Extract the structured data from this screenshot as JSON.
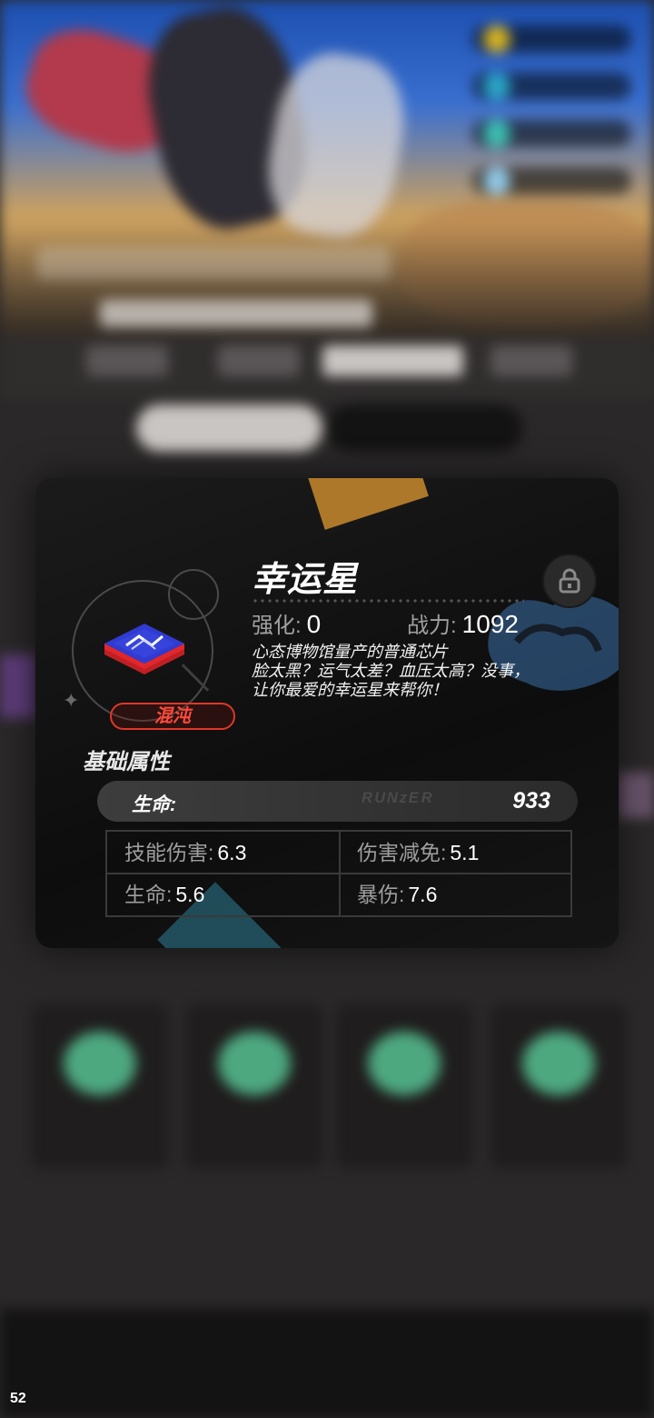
{
  "chip": {
    "name": "幸运星",
    "rarity": "混沌",
    "enhance_label": "强化:",
    "enhance_value": "0",
    "power_label": "战力:",
    "power_value": "1092",
    "description": [
      "心态博物馆量产的普通芯片",
      "脸太黑？运气太差？血压太高？没事，",
      "让你最爱的幸运星来帮你！"
    ]
  },
  "base_attributes": {
    "title": "基础属性",
    "main_label": "生命:",
    "main_value": "933"
  },
  "sub_stats": [
    {
      "label": "技能伤害:",
      "value": "6.3"
    },
    {
      "label": "伤害减免:",
      "value": "5.1"
    },
    {
      "label": "生命:",
      "value": "5.6"
    },
    {
      "label": "暴伤:",
      "value": "7.6"
    }
  ],
  "fps": "52",
  "colors": {
    "rarity_red": "#e0362a",
    "chip_blue": "#2f3bd1",
    "chip_red": "#e0282c"
  },
  "icons": {
    "lock": "lock-icon",
    "chip": "chip-icon",
    "sparkle": "sparkle-icon"
  }
}
